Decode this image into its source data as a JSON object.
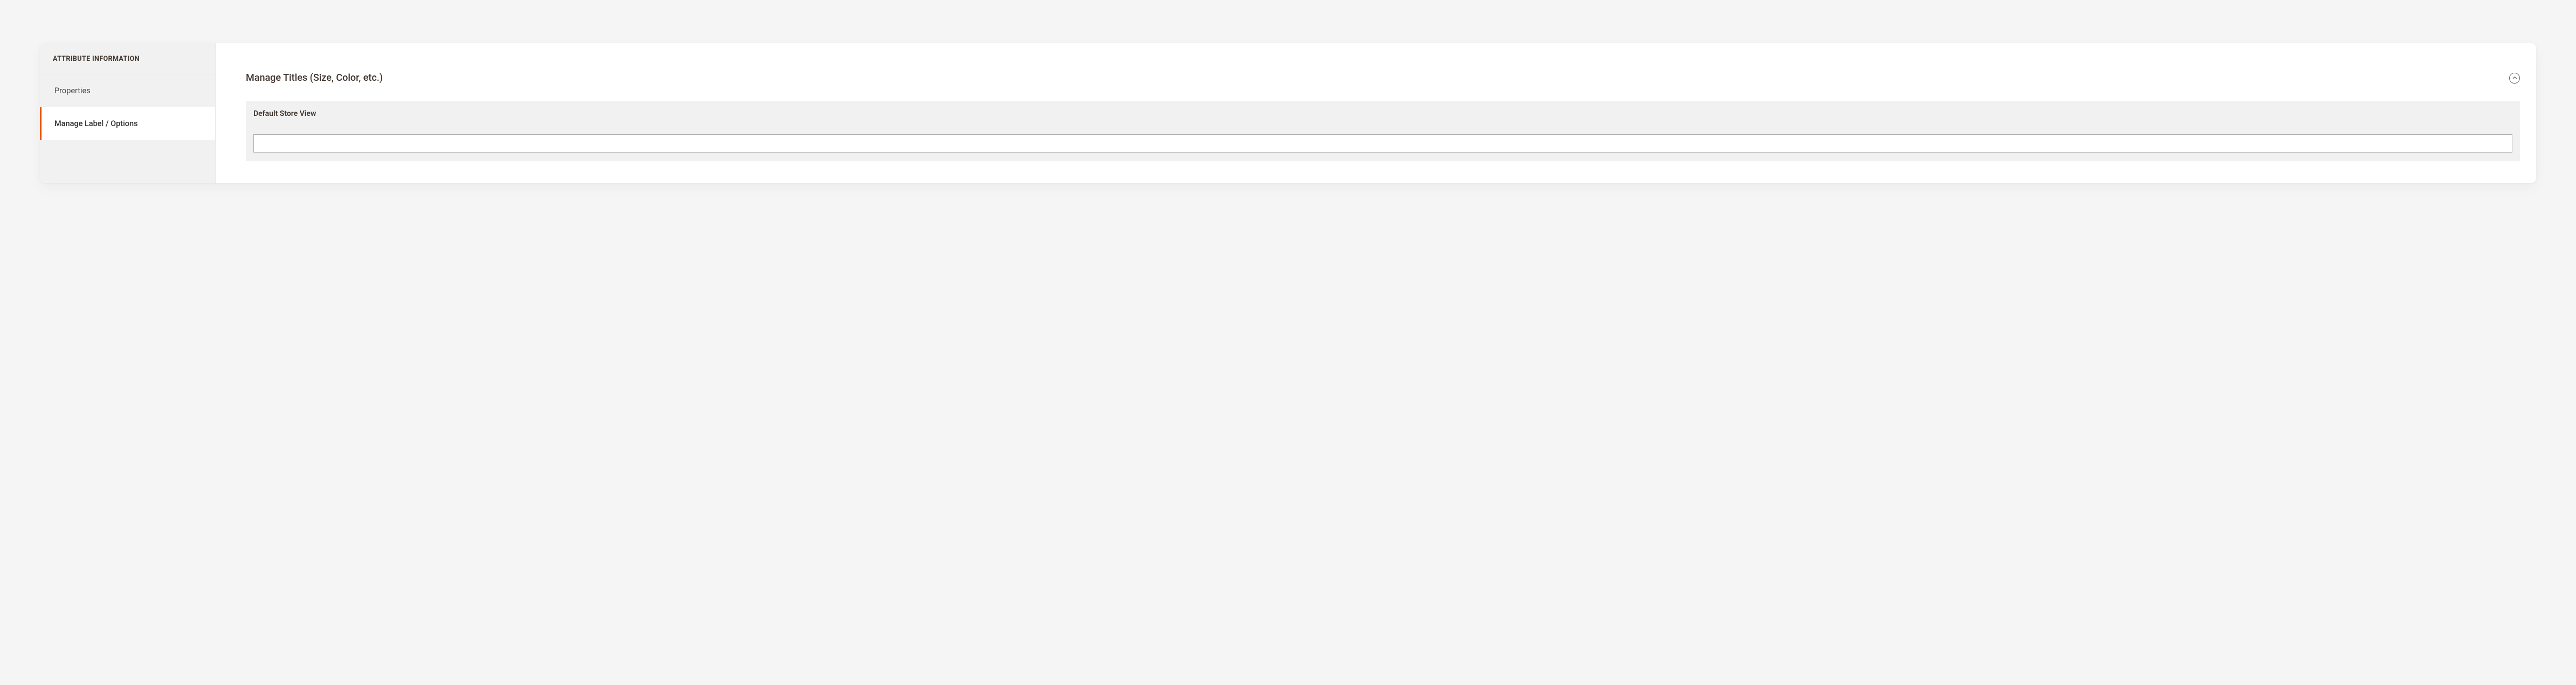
{
  "sidebar": {
    "title": "ATTRIBUTE INFORMATION",
    "items": [
      {
        "label": "Properties"
      },
      {
        "label": "Manage Label / Options"
      }
    ]
  },
  "section": {
    "title": "Manage Titles (Size, Color, etc.)",
    "field_header": "Default Store View",
    "value": ""
  }
}
